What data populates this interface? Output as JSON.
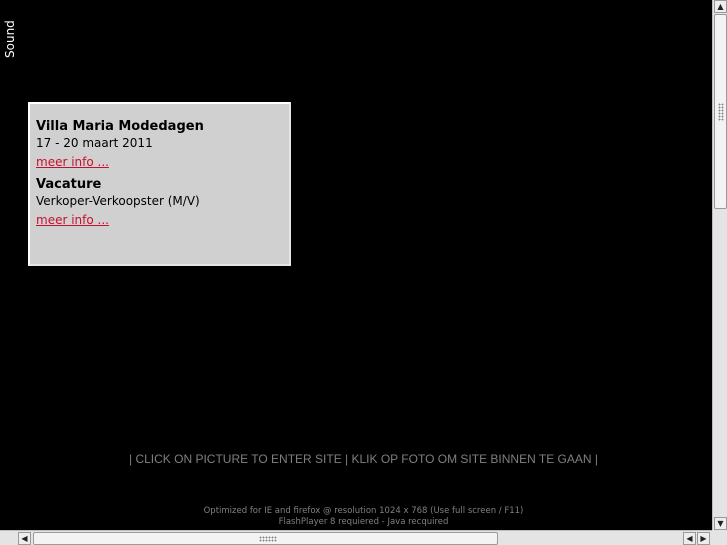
{
  "sound": {
    "label": "Sound"
  },
  "news": [
    {
      "title": "Villa Maria Modedagen",
      "subtitle": "17 - 20 maart 2011",
      "link": "meer info ..."
    },
    {
      "title": "Vacature",
      "subtitle": "Verkoper-Verkoopster (M/V)",
      "link": "meer info ..."
    }
  ],
  "enter_text": "| CLICK ON PICTURE TO ENTER SITE | KLIK OP FOTO OM SITE BINNEN TE GAAN |",
  "footer": {
    "line1": "Optimized for IE and firefox @ resolution 1024 x 768 (Use full screen / F11)",
    "line2": "FlashPlayer 8 requiered - Java recquired"
  },
  "icons": {
    "scroll_up": "arrow-up-icon",
    "scroll_down": "arrow-down-icon",
    "scroll_left": "arrow-left-icon",
    "scroll_right": "arrow-right-icon"
  },
  "colors": {
    "background": "#000000",
    "panel": "#d0d0d0",
    "link": "#c8102e",
    "enter_text": "#7f7f7f"
  }
}
